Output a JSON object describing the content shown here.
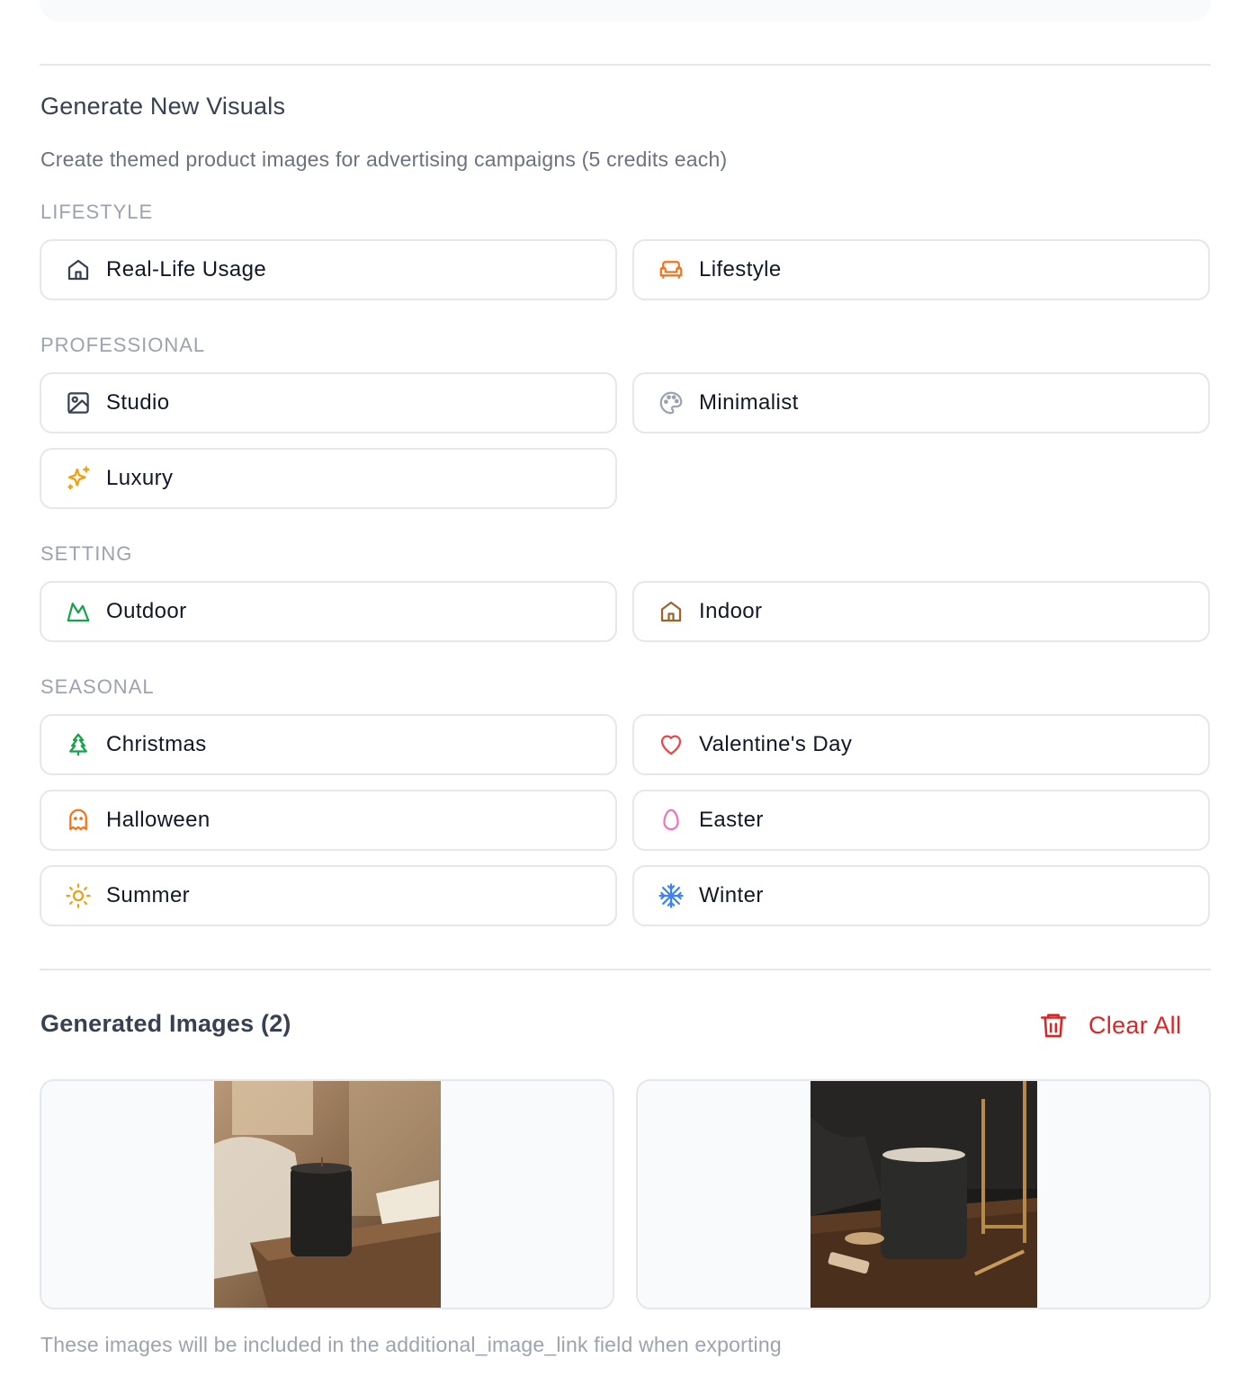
{
  "header": {
    "title": "Generate New Visuals",
    "subtitle": "Create themed product images for advertising campaigns (5 credits each)"
  },
  "categories": {
    "lifestyle": {
      "label": "LIFESTYLE",
      "options": [
        {
          "label": "Real-Life Usage",
          "icon": "home-icon",
          "color": "#374151"
        },
        {
          "label": "Lifestyle",
          "icon": "sofa-icon",
          "color": "#f97316"
        }
      ]
    },
    "professional": {
      "label": "PROFESSIONAL",
      "options": [
        {
          "label": "Studio",
          "icon": "image-icon",
          "color": "#374151"
        },
        {
          "label": "Minimalist",
          "icon": "palette-icon",
          "color": "#9ca3af"
        },
        {
          "label": "Luxury",
          "icon": "sparkles-icon",
          "color": "#f59e0b"
        }
      ]
    },
    "setting": {
      "label": "SETTING",
      "options": [
        {
          "label": "Outdoor",
          "icon": "mountain-icon",
          "color": "#16a34a"
        },
        {
          "label": "Indoor",
          "icon": "home-icon",
          "color": "#a0632a"
        }
      ]
    },
    "seasonal": {
      "label": "SEASONAL",
      "options": [
        {
          "label": "Christmas",
          "icon": "tree-icon",
          "color": "#16a34a"
        },
        {
          "label": "Valentine's Day",
          "icon": "heart-icon",
          "color": "#ef4444"
        },
        {
          "label": "Halloween",
          "icon": "ghost-icon",
          "color": "#f97316"
        },
        {
          "label": "Easter",
          "icon": "egg-icon",
          "color": "#f472b6"
        },
        {
          "label": "Summer",
          "icon": "sun-icon",
          "color": "#f59e0b"
        },
        {
          "label": "Winter",
          "icon": "snowflake-icon",
          "color": "#3b82f6"
        }
      ]
    }
  },
  "generated": {
    "title": "Generated Images (2)",
    "clear_label": "Clear All",
    "clear_color": "#dc2626",
    "images": [
      {
        "icon": "candle-photo-bedroom"
      },
      {
        "icon": "candle-photo-dark-table"
      }
    ],
    "note": "These images will be included in the additional_image_link field when exporting"
  }
}
